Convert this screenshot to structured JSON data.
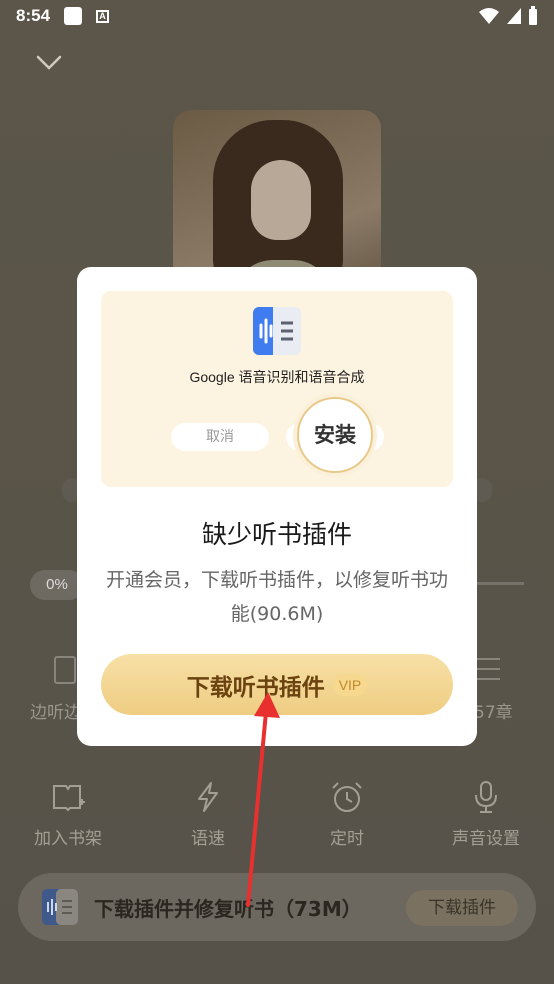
{
  "status_bar": {
    "time": "8:54"
  },
  "background": {
    "progress_pill": "0%",
    "side_left_label": "边听边",
    "side_right_label": "57章",
    "actions": [
      {
        "label": "加入书架",
        "icon": "add-bookshelf-icon"
      },
      {
        "label": "语速",
        "icon": "lightning-icon"
      },
      {
        "label": "定时",
        "icon": "alarm-clock-icon"
      },
      {
        "label": "声音设置",
        "icon": "microphone-icon"
      }
    ],
    "mini_player": {
      "text": "下载插件并修复听书（73M）",
      "button": "下载插件"
    }
  },
  "modal": {
    "illustration": {
      "plugin_name": "Google 语音识别和语音合成",
      "cancel_label": "取消",
      "install_label": "安装"
    },
    "title": "缺少听书插件",
    "description": "开通会员，下载听书插件，以修复听书功能(90.6M)",
    "action_label": "下载听书插件",
    "action_badge": "VIP"
  },
  "colors": {
    "accent": "#efcd83",
    "action_text": "#6b4310",
    "annotation_arrow": "#e8302f"
  }
}
